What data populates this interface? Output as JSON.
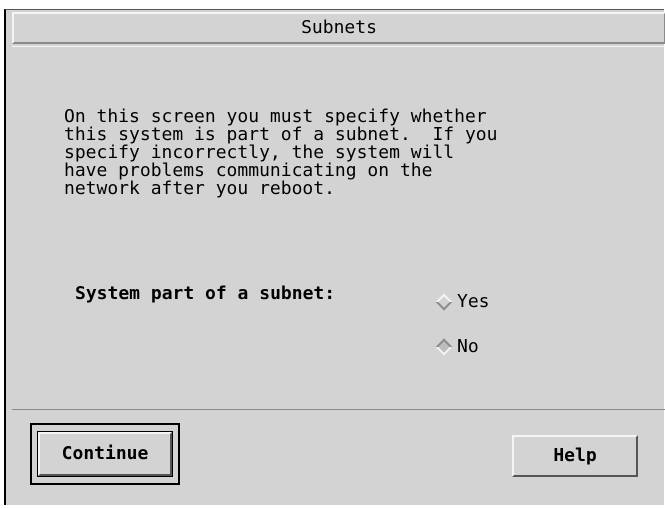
{
  "dialog": {
    "title": "Subnets",
    "message": "On this screen you must specify whether\nthis system is part of a subnet.  If you\nspecify incorrectly, the system will\nhave problems communicating on the\nnetwork after you reboot.",
    "field_label": "System part of a subnet:",
    "options": [
      {
        "label": "Yes",
        "selected": false
      },
      {
        "label": "No",
        "selected": true
      }
    ]
  },
  "buttons": {
    "continue_label": "Continue",
    "help_label": "Help"
  },
  "colors": {
    "background": "#d3d3d3",
    "highlight": "#f5f5f5",
    "shadow": "#8a8a8a",
    "text": "#000000"
  }
}
